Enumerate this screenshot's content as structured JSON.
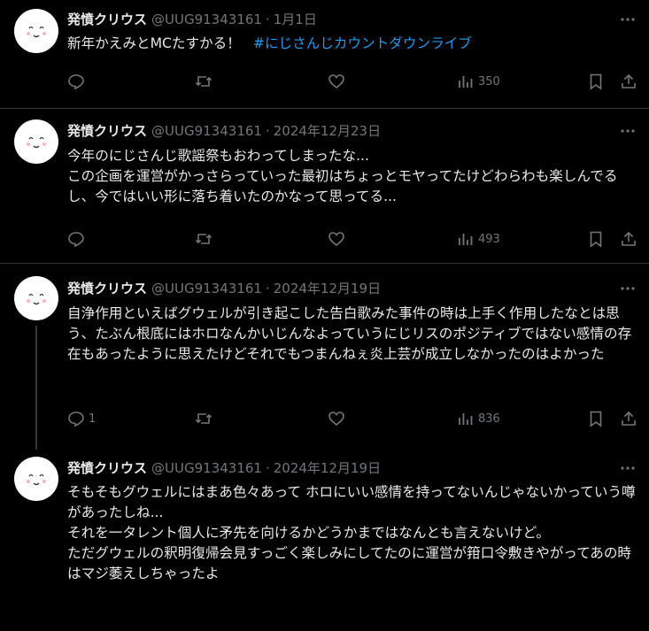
{
  "tweets": [
    {
      "name": "発憤クリウス",
      "handle": "@UUG91343161",
      "date": "1月1日",
      "text": "新年かえみとMCたすかる！",
      "hashtag": "#にじさんじカウントダウンライブ",
      "replies": "",
      "views": "350"
    },
    {
      "name": "発憤クリウス",
      "handle": "@UUG91343161",
      "date": "2024年12月23日",
      "text": "今年のにじさんじ歌謡祭もおわってしまったな...\nこの企画を運営がかっさらっていった最初はちょっとモヤってたけどわらわも楽しんでるし、今ではいい形に落ち着いたのかなって思ってる...",
      "replies": "",
      "views": "493"
    },
    {
      "name": "発憤クリウス",
      "handle": "@UUG91343161",
      "date": "2024年12月19日",
      "text": "自浄作用といえばグウェルが引き起こした告白歌みた事件の時は上手く作用したなとは思う、たぶん根底にはホロなんかいじんなよっていうにじリスのポジティブではない感情の存在もあったように思えたけどそれでもつまんねぇ炎上芸が成立しなかったのはよかった",
      "replies": "1",
      "views": "836"
    },
    {
      "name": "発憤クリウス",
      "handle": "@UUG91343161",
      "date": "2024年12月19日",
      "text": "そもそもグウェルにはまあ色々あって ホロにいい感情を持ってないんじゃないかっていう噂があったしね...\nそれを一タレント個人に矛先を向けるかどうかまではなんとも言えないけど。\nただグウェルの釈明復帰会見すっごく楽しみにしてたのに運営が箝口令敷きやがってあの時はマジ萎えしちゃったよ",
      "replies": "",
      "views": ""
    }
  ]
}
